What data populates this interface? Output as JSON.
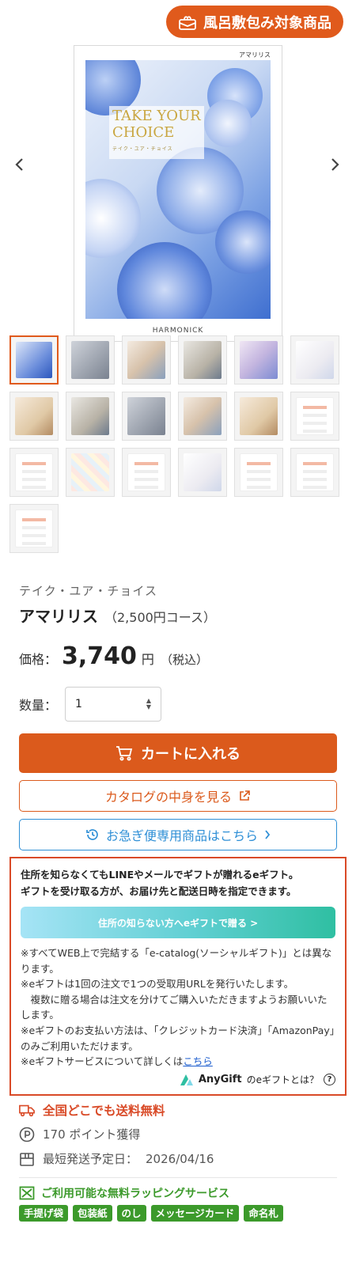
{
  "gallery": {
    "badge_label": "風呂敷包み対象商品",
    "cover": {
      "brand_top": "アマリリス",
      "title_line1": "TAKE YOUR",
      "title_line2": "CHOICE",
      "subtitle": "テイク・ユア・チョイス",
      "brand_bottom": "HARMONICK"
    },
    "thumbnails": [
      {
        "style": "t-blue",
        "tag": "",
        "active": true
      },
      {
        "style": "t-gray",
        "tag": ""
      },
      {
        "style": "t-people",
        "tag": ""
      },
      {
        "style": "t-photo",
        "tag": ""
      },
      {
        "style": "t-cards",
        "tag": ""
      },
      {
        "style": "t-light",
        "tag": ""
      },
      {
        "style": "t-food",
        "tag": ""
      },
      {
        "style": "t-photo",
        "tag": ""
      },
      {
        "style": "t-gray",
        "tag": ""
      },
      {
        "style": "t-people",
        "tag": ""
      },
      {
        "style": "t-food",
        "tag": ""
      },
      {
        "style": "t-doc",
        "tag": ""
      },
      {
        "style": "t-doc",
        "tag": ""
      },
      {
        "style": "t-pattern",
        "tag": ""
      },
      {
        "style": "t-doc",
        "tag": ""
      },
      {
        "style": "t-light",
        "tag": ""
      },
      {
        "style": "t-doc",
        "tag": ""
      },
      {
        "style": "t-doc",
        "tag": ""
      },
      {
        "style": "t-doc",
        "tag": ""
      }
    ]
  },
  "product": {
    "brand": "テイク・ユア・チョイス",
    "name": "アマリリス",
    "course": "（2,500円コース）",
    "price_label": "価格：",
    "price_value": "3,740",
    "price_unit": "円",
    "price_tax": "（税込）",
    "qty_label": "数量：",
    "qty_value": "1"
  },
  "buttons": {
    "cart": "カートに入れる",
    "catalog": "カタログの中身を見る",
    "express": "お急ぎ便専用商品はこちら"
  },
  "egift": {
    "lead_line1": "住所を知らなくてもLINEやメールでギフトが贈れるeギフト。",
    "lead_line2": "ギフトを受け取る方が、お届け先と配送日時を指定できます。",
    "button": "住所の知らない方へeギフトで贈る >",
    "note1": "※すべてWEB上で完結する「e-catalog(ソーシャルギフト)」とは異なります。",
    "note2": "※eギフトは1回の注文で1つの受取用URLを発行いたします。",
    "note3": "　複数に贈る場合は注文を分けてご購入いただきますようお願いいたします。",
    "note4": "※eギフトのお支払い方法は、「クレジットカード決済」「AmazonPay」のみご利用いただけます。",
    "note5_prefix": "※eギフトサービスについて詳しくは",
    "note5_link": "こちら",
    "anygift_brand": "AnyGift",
    "anygift_question": "のeギフトとは？",
    "help_symbol": "?"
  },
  "delivery": {
    "shipping": "全国どこでも送料無料",
    "points": "170 ポイント獲得",
    "ship_date_label": "最短発送予定日：",
    "ship_date_value": "2026/04/16"
  },
  "wrapping": {
    "title": "ご利用可能な無料ラッピングサービス",
    "tags": [
      "手提げ袋",
      "包装紙",
      "のし",
      "メッセージカード",
      "命名札"
    ]
  },
  "colors": {
    "accent_orange": "#db5a1c",
    "express_blue": "#2f8fd6",
    "egift_border": "#d94a27",
    "wrap_green": "#3c9a2b"
  }
}
